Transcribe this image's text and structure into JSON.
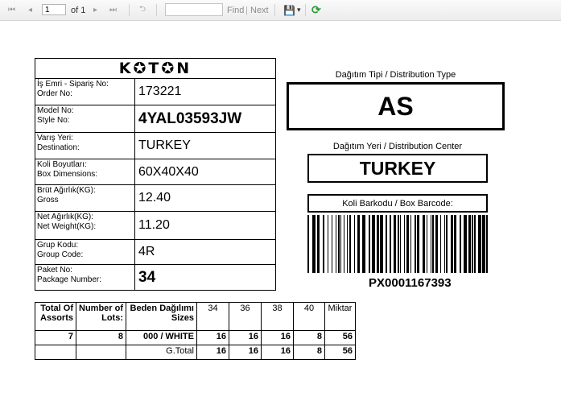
{
  "toolbar": {
    "first_icon": "⏮",
    "prev_icon": "◂",
    "page_value": "1",
    "of_label": "of 1",
    "next_icon": "▸",
    "last_icon": "⏭",
    "back_icon": "⮌",
    "find_label": "Find",
    "separator": "|",
    "next_label": "Next",
    "save_icon": "💾",
    "dropdown_icon": "▾",
    "refresh_icon": "⟳"
  },
  "label": {
    "brand": "K✪T✪N",
    "fields": [
      {
        "label1": "İş Emri - Sipariş No:",
        "label2": "Order No:",
        "value": "173221"
      },
      {
        "label1": "Model No:",
        "label2": "Style No:",
        "value": "4YAL03593JW"
      },
      {
        "label1": "Varış Yeri:",
        "label2": "Destination:",
        "value": "TURKEY"
      },
      {
        "label1": "Koli Boyutları:",
        "label2": "Box Dimensions:",
        "value": "60X40X40"
      },
      {
        "label1": "Brüt Ağırlık(KG):",
        "label2": "Gross",
        "value": "12.40"
      },
      {
        "label1": "Net Ağırlık(KG):",
        "label2": "Net Weight(KG):",
        "value": "11.20"
      },
      {
        "label1": "Grup Kodu:",
        "label2": "Group Code:",
        "value": "4R"
      },
      {
        "label1": "Paket No:",
        "label2": "Package Number:",
        "value": "34"
      }
    ],
    "distribution_type_caption": "Dağıtım Tipi / Distribution Type",
    "distribution_type": "AS",
    "distribution_center_caption": "Dağıtım Yeri / Distribution Center",
    "distribution_center": "TURKEY",
    "barcode_caption": "Koli Barkodu / Box Barcode:",
    "barcode_value": "PX0001167393"
  },
  "assort_table": {
    "headers": [
      "Total Of Assorts",
      "Number of Lots:",
      "Beden Dağılımı Sizes",
      "34",
      "36",
      "38",
      "40",
      "Miktar"
    ],
    "row": [
      "7",
      "8",
      "000 / WHITE",
      "16",
      "16",
      "16",
      "8",
      "56"
    ],
    "total": [
      "",
      "",
      "G.Total",
      "16",
      "16",
      "16",
      "8",
      "56"
    ]
  }
}
